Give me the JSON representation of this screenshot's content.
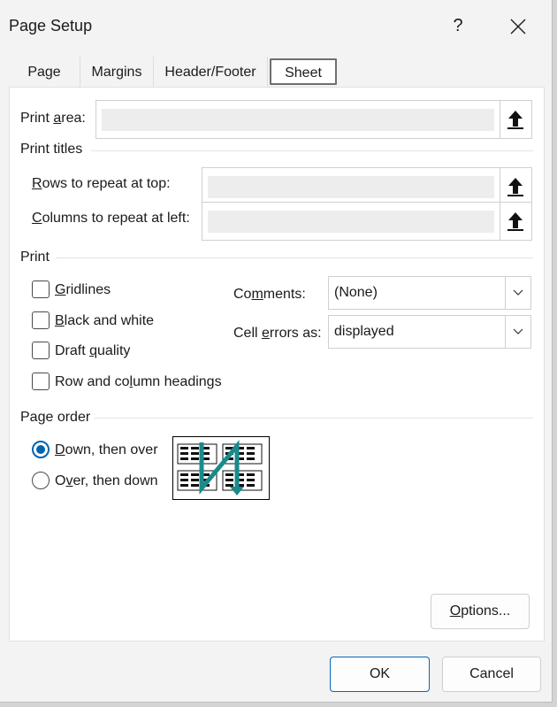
{
  "window": {
    "title": "Page Setup",
    "help": "?"
  },
  "tabs": [
    {
      "label": "Page",
      "active": false
    },
    {
      "label": "Margins",
      "active": false
    },
    {
      "label": "Header/Footer",
      "active": false
    },
    {
      "label": "Sheet",
      "active": true
    }
  ],
  "print_area": {
    "label_pre": "Print ",
    "label_u": "a",
    "label_post": "rea:",
    "value": ""
  },
  "print_titles": {
    "heading": "Print titles",
    "rows": {
      "label_u": "R",
      "label_post": "ows to repeat at top:",
      "value": ""
    },
    "cols": {
      "label_u": "C",
      "label_post": "olumns to repeat at left:",
      "value": ""
    }
  },
  "print": {
    "heading": "Print",
    "gridlines": {
      "label_u": "G",
      "label_post": "ridlines",
      "checked": false
    },
    "black_white": {
      "label_u": "B",
      "label_post": "lack and white",
      "checked": false
    },
    "draft": {
      "label_pre": "Draft ",
      "label_u": "q",
      "label_post": "uality",
      "checked": false
    },
    "headings": {
      "label_pre": "Row and co",
      "label_u": "l",
      "label_post": "umn headings",
      "checked": false
    },
    "comments": {
      "label_pre": "Co",
      "label_u": "m",
      "label_post": "ments:",
      "value": "(None)"
    },
    "cell_errors": {
      "label_pre": "Cell ",
      "label_u": "e",
      "label_post": "rrors as:",
      "value": "displayed"
    }
  },
  "page_order": {
    "heading": "Page order",
    "down_over": {
      "label_u": "D",
      "label_post": "own, then over",
      "selected": true
    },
    "over_down": {
      "label_pre": "O",
      "label_u": "v",
      "label_post": "er, then down",
      "selected": false
    }
  },
  "buttons": {
    "options_u": "O",
    "options_post": "ptions...",
    "ok": "OK",
    "cancel": "Cancel"
  },
  "colors": {
    "accent": "#0063b1",
    "arrow": "#1a8a8a"
  }
}
